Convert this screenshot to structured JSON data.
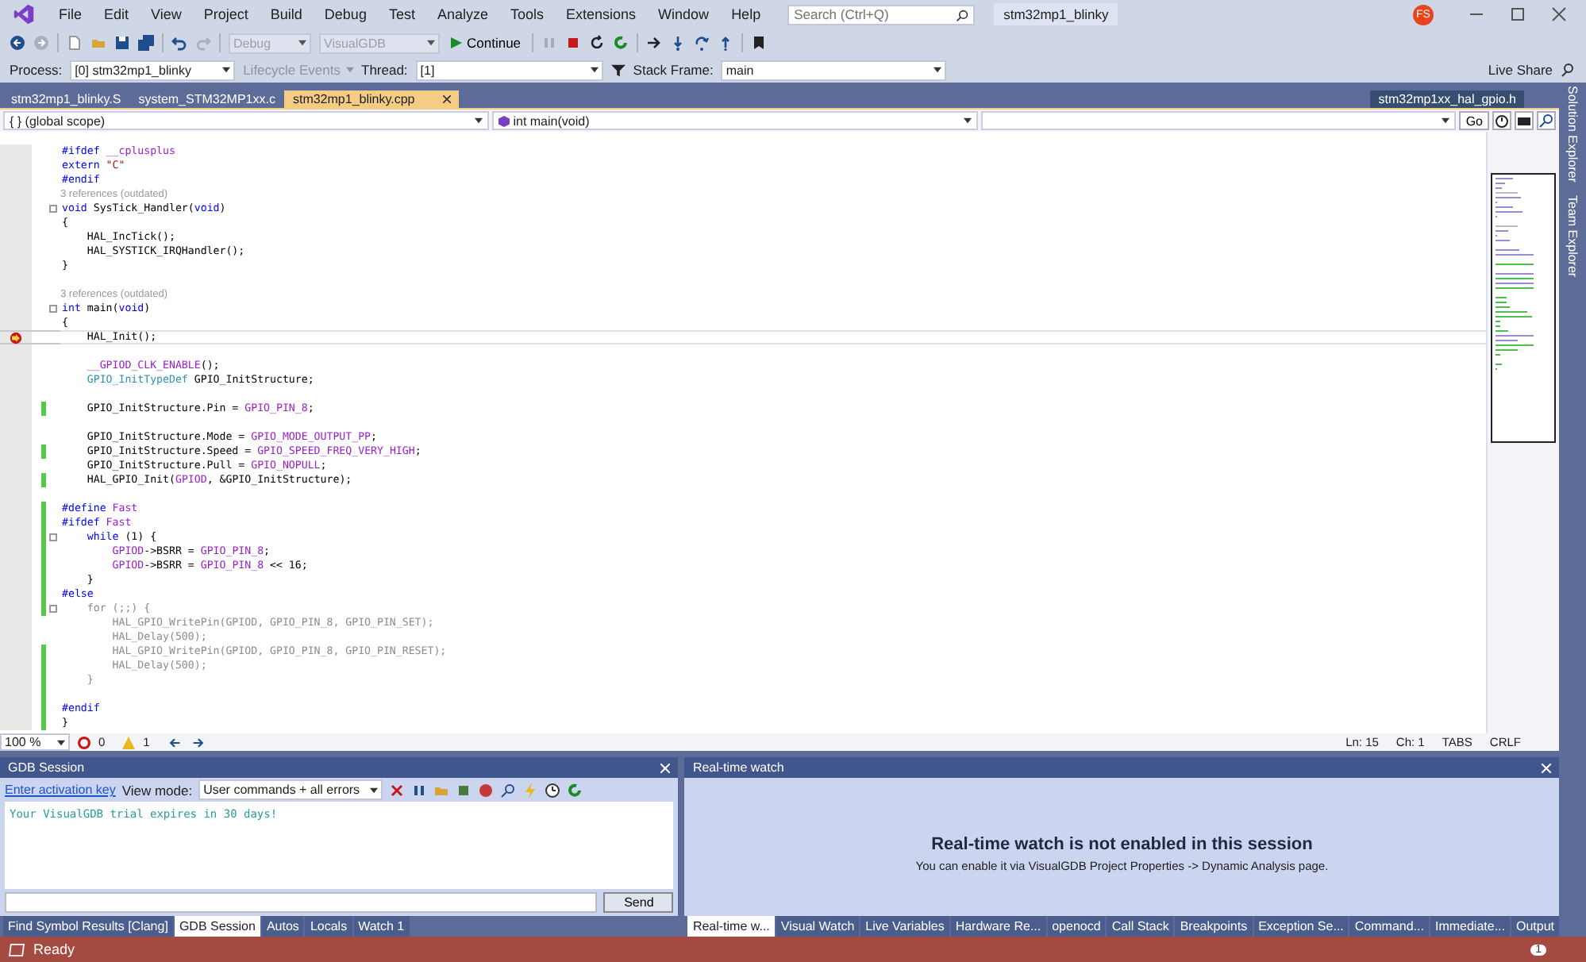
{
  "title_bar": {
    "menu": [
      "File",
      "Edit",
      "View",
      "Project",
      "Build",
      "Debug",
      "Test",
      "Analyze",
      "Tools",
      "Extensions",
      "Window",
      "Help"
    ],
    "search": {
      "placeholder": "Search (Ctrl+Q)"
    },
    "solution_name": "stm32mp1_blinky",
    "avatar_initials": "FS",
    "live_share": "Live Share"
  },
  "debug_toolbar": {
    "configuration": {
      "value": "Debug",
      "disabled": true
    },
    "platform": {
      "value": "VisualGDB",
      "disabled": true
    },
    "continue": "Continue"
  },
  "debug_location": {
    "process_label": "Process:",
    "process": "[0] stm32mp1_blinky",
    "lifecycle": {
      "label": "Lifecycle Events",
      "disabled": true
    },
    "thread_label": "Thread:",
    "thread": "[1]",
    "stack_frame_label": "Stack Frame:",
    "stack_frame": "main"
  },
  "document_tabs": [
    {
      "label": "stm32mp1_blinky.S",
      "selected": false
    },
    {
      "label": "system_STM32MP1xx.c",
      "selected": false
    },
    {
      "label": "stm32mp1_blinky.cpp",
      "selected": true
    }
  ],
  "right_tab": "stm32mp1xx_hal_gpio.h",
  "navigation": {
    "scope_icon": "{ }",
    "scope": "(global scope)",
    "member": "int main(void)",
    "go": "Go"
  },
  "code_lines": [
    {
      "kind": "code",
      "changed": false,
      "fold": false,
      "breakpoint": false,
      "current": false,
      "tokens": [
        {
          "kind": "keyword",
          "text": "#ifdef "
        },
        {
          "kind": "macro",
          "text": "__cplusplus"
        }
      ]
    },
    {
      "kind": "code",
      "changed": false,
      "fold": false,
      "breakpoint": false,
      "current": false,
      "tokens": [
        {
          "kind": "keyword",
          "text": "extern"
        },
        {
          "kind": "string",
          "text": " \"C\""
        }
      ]
    },
    {
      "kind": "code",
      "changed": false,
      "fold": false,
      "breakpoint": false,
      "current": false,
      "tokens": [
        {
          "kind": "keyword",
          "text": "#endif"
        }
      ]
    },
    {
      "kind": "lens",
      "changed": false,
      "fold": false,
      "breakpoint": false,
      "current": false,
      "tokens": [
        {
          "kind": "plain",
          "text": "3 references (outdated)"
        }
      ]
    },
    {
      "kind": "code",
      "changed": false,
      "fold": true,
      "breakpoint": false,
      "current": false,
      "tokens": [
        {
          "kind": "keyword",
          "text": "void"
        },
        {
          "kind": "plain",
          "text": " SysTick_Handler("
        },
        {
          "kind": "keyword",
          "text": "void"
        },
        {
          "kind": "plain",
          "text": ")"
        }
      ]
    },
    {
      "kind": "code",
      "changed": false,
      "fold": false,
      "breakpoint": false,
      "current": false,
      "tokens": [
        {
          "kind": "plain",
          "text": "{"
        }
      ]
    },
    {
      "kind": "code",
      "changed": false,
      "fold": false,
      "breakpoint": false,
      "current": false,
      "tokens": [
        {
          "kind": "plain",
          "text": "    HAL_IncTick();"
        }
      ]
    },
    {
      "kind": "code",
      "changed": false,
      "fold": false,
      "breakpoint": false,
      "current": false,
      "tokens": [
        {
          "kind": "plain",
          "text": "    HAL_SYSTICK_IRQHandler();"
        }
      ]
    },
    {
      "kind": "code",
      "changed": false,
      "fold": false,
      "breakpoint": false,
      "current": false,
      "tokens": [
        {
          "kind": "plain",
          "text": "}"
        }
      ]
    },
    {
      "kind": "code",
      "changed": false,
      "fold": false,
      "breakpoint": false,
      "current": false
    },
    {
      "kind": "lens",
      "changed": false,
      "fold": false,
      "breakpoint": false,
      "current": false,
      "tokens": [
        {
          "kind": "plain",
          "text": "3 references (outdated)"
        }
      ]
    },
    {
      "kind": "code",
      "changed": false,
      "fold": true,
      "breakpoint": false,
      "current": false,
      "tokens": [
        {
          "kind": "keyword",
          "text": "int"
        },
        {
          "kind": "plain",
          "text": " main("
        },
        {
          "kind": "keyword",
          "text": "void"
        },
        {
          "kind": "plain",
          "text": ")"
        }
      ]
    },
    {
      "kind": "code",
      "changed": false,
      "fold": false,
      "breakpoint": false,
      "current": false,
      "tokens": [
        {
          "kind": "plain",
          "text": "{"
        }
      ]
    },
    {
      "kind": "code",
      "changed": false,
      "fold": false,
      "breakpoint": true,
      "current": true,
      "tokens": [
        {
          "kind": "plain",
          "text": "    HAL_Init();"
        }
      ]
    },
    {
      "kind": "code",
      "changed": false,
      "fold": false,
      "breakpoint": false,
      "current": false
    },
    {
      "kind": "code",
      "changed": false,
      "fold": false,
      "breakpoint": false,
      "current": false,
      "tokens": [
        {
          "kind": "macro",
          "text": "    __GPIOD_CLK_ENABLE"
        },
        {
          "kind": "plain",
          "text": "();"
        }
      ]
    },
    {
      "kind": "code",
      "changed": false,
      "fold": false,
      "breakpoint": false,
      "current": false,
      "tokens": [
        {
          "kind": "type",
          "text": "    GPIO_InitTypeDef"
        },
        {
          "kind": "plain",
          "text": " GPIO_InitStructure;"
        }
      ]
    },
    {
      "kind": "code",
      "changed": false,
      "fold": false,
      "breakpoint": false,
      "current": false
    },
    {
      "kind": "code",
      "changed": true,
      "fold": false,
      "breakpoint": false,
      "current": false,
      "tokens": [
        {
          "kind": "plain",
          "text": "    GPIO_InitStructure.Pin = "
        },
        {
          "kind": "macro",
          "text": "GPIO_PIN_8"
        },
        {
          "kind": "plain",
          "text": ";"
        }
      ]
    },
    {
      "kind": "code",
      "changed": false,
      "fold": false,
      "breakpoint": false,
      "current": false
    },
    {
      "kind": "code",
      "changed": false,
      "fold": false,
      "breakpoint": false,
      "current": false,
      "tokens": [
        {
          "kind": "plain",
          "text": "    GPIO_InitStructure.Mode = "
        },
        {
          "kind": "macro",
          "text": "GPIO_MODE_OUTPUT_PP"
        },
        {
          "kind": "plain",
          "text": ";"
        }
      ]
    },
    {
      "kind": "code",
      "changed": true,
      "fold": false,
      "breakpoint": false,
      "current": false,
      "tokens": [
        {
          "kind": "plain",
          "text": "    GPIO_InitStructure.Speed = "
        },
        {
          "kind": "macro",
          "text": "GPIO_SPEED_FREQ_VERY_HIGH"
        },
        {
          "kind": "plain",
          "text": ";"
        }
      ]
    },
    {
      "kind": "code",
      "changed": false,
      "fold": false,
      "breakpoint": false,
      "current": false,
      "tokens": [
        {
          "kind": "plain",
          "text": "    GPIO_InitStructure.Pull = "
        },
        {
          "kind": "macro",
          "text": "GPIO_NOPULL"
        },
        {
          "kind": "plain",
          "text": ";"
        }
      ]
    },
    {
      "kind": "code",
      "changed": true,
      "fold": false,
      "breakpoint": false,
      "current": false,
      "tokens": [
        {
          "kind": "plain",
          "text": "    HAL_GPIO_Init("
        },
        {
          "kind": "macro",
          "text": "GPIOD"
        },
        {
          "kind": "plain",
          "text": ", &GPIO_InitStructure);"
        }
      ]
    },
    {
      "kind": "code",
      "changed": false,
      "fold": false,
      "breakpoint": false,
      "current": false
    },
    {
      "kind": "code",
      "changed": true,
      "fold": false,
      "breakpoint": false,
      "current": false,
      "tokens": [
        {
          "kind": "keyword",
          "text": "#define "
        },
        {
          "kind": "macro",
          "text": "Fast"
        }
      ]
    },
    {
      "kind": "code",
      "changed": true,
      "fold": false,
      "breakpoint": false,
      "current": false,
      "tokens": [
        {
          "kind": "keyword",
          "text": "#ifdef "
        },
        {
          "kind": "macro",
          "text": "Fast"
        }
      ]
    },
    {
      "kind": "code",
      "changed": true,
      "fold": true,
      "breakpoint": false,
      "current": false,
      "tokens": [
        {
          "kind": "keyword",
          "text": "    while"
        },
        {
          "kind": "plain",
          "text": " (1) {"
        }
      ]
    },
    {
      "kind": "code",
      "changed": true,
      "fold": false,
      "breakpoint": false,
      "current": false,
      "tokens": [
        {
          "kind": "macro",
          "text": "        GPIOD"
        },
        {
          "kind": "plain",
          "text": "->BSRR = "
        },
        {
          "kind": "macro",
          "text": "GPIO_PIN_8"
        },
        {
          "kind": "plain",
          "text": ";"
        }
      ]
    },
    {
      "kind": "code",
      "changed": true,
      "fold": false,
      "breakpoint": false,
      "current": false,
      "tokens": [
        {
          "kind": "macro",
          "text": "        GPIOD"
        },
        {
          "kind": "plain",
          "text": "->BSRR = "
        },
        {
          "kind": "macro",
          "text": "GPIO_PIN_8"
        },
        {
          "kind": "plain",
          "text": " << 16;"
        }
      ]
    },
    {
      "kind": "code",
      "changed": true,
      "fold": false,
      "breakpoint": false,
      "current": false,
      "tokens": [
        {
          "kind": "plain",
          "text": "    }"
        }
      ]
    },
    {
      "kind": "code",
      "changed": true,
      "fold": false,
      "breakpoint": false,
      "current": false,
      "tokens": [
        {
          "kind": "keyword",
          "text": "#else"
        }
      ]
    },
    {
      "kind": "code",
      "changed": true,
      "fold": true,
      "breakpoint": false,
      "current": false,
      "tokens": [
        {
          "kind": "inactive",
          "text": "    for (;;) {"
        }
      ]
    },
    {
      "kind": "code",
      "changed": false,
      "fold": false,
      "breakpoint": false,
      "current": false,
      "tokens": [
        {
          "kind": "inactive",
          "text": "        HAL_GPIO_WritePin(GPIOD, GPIO_PIN_8, GPIO_PIN_SET);"
        }
      ]
    },
    {
      "kind": "code",
      "changed": false,
      "fold": false,
      "breakpoint": false,
      "current": false,
      "tokens": [
        {
          "kind": "inactive",
          "text": "        HAL_Delay(500);"
        }
      ]
    },
    {
      "kind": "code",
      "changed": true,
      "fold": false,
      "breakpoint": false,
      "current": false,
      "tokens": [
        {
          "kind": "inactive",
          "text": "        HAL_GPIO_WritePin(GPIOD, GPIO_PIN_8, GPIO_PIN_RESET);"
        }
      ]
    },
    {
      "kind": "code",
      "changed": true,
      "fold": false,
      "breakpoint": false,
      "current": false,
      "tokens": [
        {
          "kind": "inactive",
          "text": "        HAL_Delay(500);"
        }
      ]
    },
    {
      "kind": "code",
      "changed": true,
      "fold": false,
      "breakpoint": false,
      "current": false,
      "tokens": [
        {
          "kind": "inactive",
          "text": "    }"
        }
      ]
    },
    {
      "kind": "code",
      "changed": true,
      "fold": false,
      "breakpoint": false,
      "current": false
    },
    {
      "kind": "code",
      "changed": true,
      "fold": false,
      "breakpoint": false,
      "current": false,
      "tokens": [
        {
          "kind": "keyword",
          "text": "#endif"
        }
      ]
    },
    {
      "kind": "code",
      "changed": true,
      "fold": false,
      "breakpoint": false,
      "current": false,
      "tokens": [
        {
          "kind": "plain",
          "text": "}"
        }
      ]
    }
  ],
  "editor_status": {
    "zoom": "100 %",
    "errors": "0",
    "warnings": "1",
    "line": "Ln: 15",
    "column": "Ch: 1",
    "indent": "TABS",
    "line_ending": "CRLF"
  },
  "gdb_panel": {
    "title": "GDB Session",
    "activation_link": "Enter activation key",
    "view_mode_label": "View mode:",
    "view_mode": "User commands + all errors",
    "output": "Your VisualGDB trial expires in 30 days!",
    "send": "Send",
    "tabs": [
      {
        "label": "Find Symbol Results [Clang]",
        "selected": false
      },
      {
        "label": "GDB Session",
        "selected": true
      },
      {
        "label": "Autos",
        "selected": false
      },
      {
        "label": "Locals",
        "selected": false
      },
      {
        "label": "Watch 1",
        "selected": false
      }
    ]
  },
  "watch_panel": {
    "title": "Real-time watch",
    "heading": "Real-time watch is not enabled in this session",
    "message": "You can enable it via VisualGDB Project Properties -> Dynamic Analysis page.",
    "tabs": [
      {
        "label": "Real-time w...",
        "selected": true
      },
      {
        "label": "Visual Watch",
        "selected": false
      },
      {
        "label": "Live Variables",
        "selected": false
      },
      {
        "label": "Hardware Re...",
        "selected": false
      },
      {
        "label": "openocd",
        "selected": false
      },
      {
        "label": "Call Stack",
        "selected": false
      },
      {
        "label": "Breakpoints",
        "selected": false
      },
      {
        "label": "Exception Se...",
        "selected": false
      },
      {
        "label": "Command...",
        "selected": false
      },
      {
        "label": "Immediate...",
        "selected": false
      },
      {
        "label": "Output",
        "selected": false
      }
    ]
  },
  "side_tabs": [
    "Solution Explorer",
    "Team Explorer"
  ],
  "status_bar": {
    "text": "Ready",
    "notifications": "1"
  }
}
